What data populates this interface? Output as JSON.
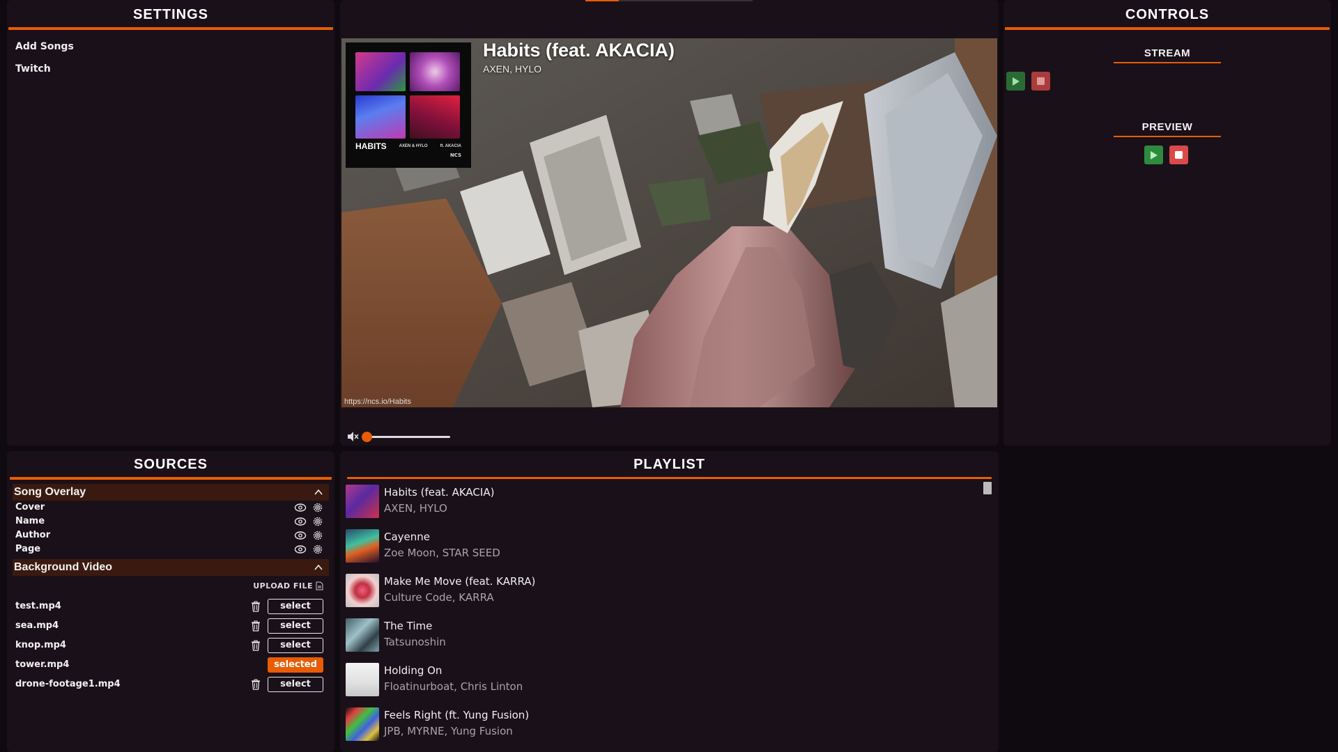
{
  "settings": {
    "title": "SETTINGS",
    "items": [
      {
        "label": "Add Songs"
      },
      {
        "label": "Twitch"
      }
    ]
  },
  "preview": {
    "overlay": {
      "title": "Habits (feat. AKACIA)",
      "author": "AXEN, HYLO",
      "page": "https://ncs.io/Habits",
      "cover_text": "HABITS",
      "cover_artists": "AXEN & HYLO",
      "cover_feat": "ft. AKACIA",
      "cover_label": "NCS"
    },
    "volume": {
      "muted": true,
      "level": 0
    }
  },
  "controls": {
    "title": "CONTROLS",
    "stream": {
      "label": "STREAM"
    },
    "preview": {
      "label": "PREVIEW"
    }
  },
  "sources": {
    "title": "SOURCES",
    "song_overlay": {
      "label": "Song Overlay",
      "items": [
        {
          "label": "Cover"
        },
        {
          "label": "Name"
        },
        {
          "label": "Author"
        },
        {
          "label": "Page"
        }
      ]
    },
    "background_video": {
      "label": "Background Video",
      "upload_label": "UPLOAD FILE",
      "select_label": "select",
      "selected_label": "selected",
      "files": [
        {
          "name": "test.mp4",
          "selected": false
        },
        {
          "name": "sea.mp4",
          "selected": false
        },
        {
          "name": "knop.mp4",
          "selected": false
        },
        {
          "name": "tower.mp4",
          "selected": true
        },
        {
          "name": "drone-footage1.mp4",
          "selected": false
        }
      ]
    }
  },
  "playlist": {
    "title": "PLAYLIST",
    "items": [
      {
        "title": "Habits (feat. AKACIA)",
        "artist": "AXEN, HYLO"
      },
      {
        "title": "Cayenne",
        "artist": "Zoe Moon, STAR SEED"
      },
      {
        "title": "Make Me Move (feat. KARRA)",
        "artist": "Culture Code, KARRA"
      },
      {
        "title": "The Time",
        "artist": "Tatsunoshin"
      },
      {
        "title": "Holding On",
        "artist": "Floatinurboat, Chris Linton"
      },
      {
        "title": "Feels Right (ft. Yung Fusion)",
        "artist": "JPB, MYRNE, Yung Fusion"
      }
    ]
  },
  "colors": {
    "accent": "#e85d04",
    "panel": "#1a1019",
    "background": "#0f0a0f",
    "play_green": "#2e8b3e",
    "stop_red": "#d94a4a"
  },
  "icons": [
    "play-icon",
    "stop-icon",
    "mute-icon",
    "eye-icon",
    "gear-icon",
    "chevron-up-icon",
    "trash-icon",
    "file-icon"
  ]
}
